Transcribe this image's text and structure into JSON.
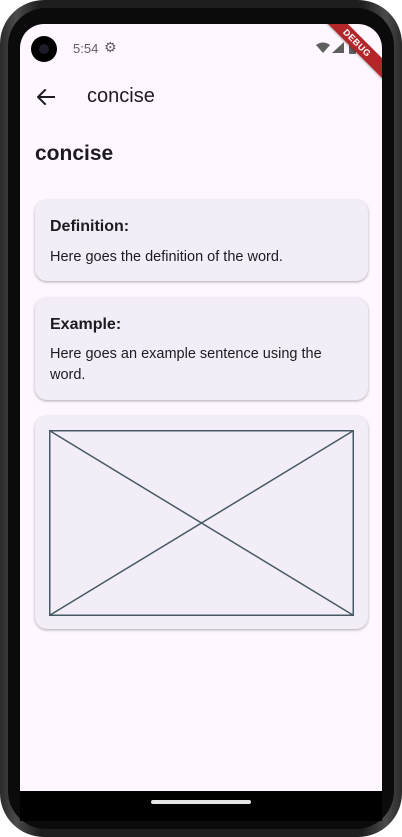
{
  "status_bar": {
    "time": "5:54",
    "debug_banner": "DEBUG",
    "icons": [
      "settings-gear-icon",
      "wifi-icon",
      "signal-icon",
      "battery-icon"
    ]
  },
  "app_bar": {
    "back_icon": "arrow-back-icon",
    "title": "concise"
  },
  "word": {
    "heading": "concise"
  },
  "definition_card": {
    "title": "Definition:",
    "body": "Here goes the definition of the word."
  },
  "example_card": {
    "title": "Example:",
    "body": "Here goes an example sentence using the word."
  },
  "image_card": {
    "placeholder_icon": "image-placeholder-icon"
  },
  "colors": {
    "background": "#fef7ff",
    "card": "#f3edf7",
    "text": "#1d1b20",
    "placeholder_stroke": "#455a64",
    "debug_banner": "#b3262a"
  }
}
